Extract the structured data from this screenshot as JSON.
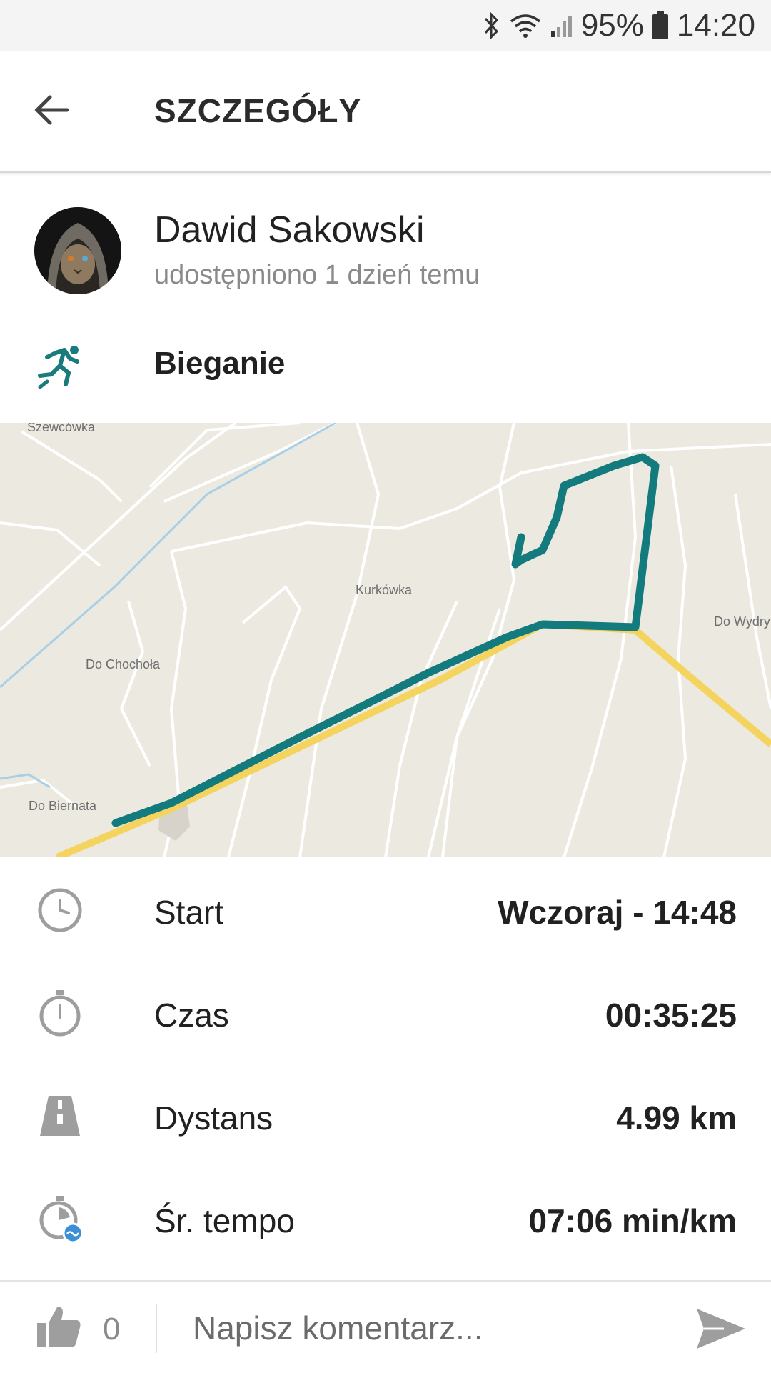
{
  "status_bar": {
    "battery": "95%",
    "time": "14:20",
    "icons": [
      "bluetooth-icon",
      "wifi-icon",
      "signal-icon",
      "battery-icon"
    ]
  },
  "app_bar": {
    "title": "SZCZEGÓŁY",
    "back_icon": "arrow-back-icon"
  },
  "profile": {
    "name": "Dawid Sakowski",
    "shared": "udostępniono 1 dzień temu"
  },
  "activity": {
    "icon": "running-icon",
    "label": "Bieganie",
    "accent": "#1a7a7c"
  },
  "map": {
    "labels": [
      "Szewcówka",
      "Kurkówka",
      "Do Chochoła",
      "Do Wydry",
      "Do Biernata"
    ],
    "route_color": "#137a7d",
    "road_color": "#f7dc6a"
  },
  "stats": [
    {
      "icon": "clock-icon",
      "label": "Start",
      "value": "Wczoraj - 14:48"
    },
    {
      "icon": "stopwatch-icon",
      "label": "Czas",
      "value": "00:35:25"
    },
    {
      "icon": "road-icon",
      "label": "Dystans",
      "value": "4.99 km"
    },
    {
      "icon": "pace-icon",
      "label": "Śr. tempo",
      "value": "07:06 min/km"
    }
  ],
  "bottom_bar": {
    "like_icon": "thumbs-up-icon",
    "likes": "0",
    "comment_placeholder": "Napisz komentarz...",
    "send_icon": "send-icon"
  }
}
